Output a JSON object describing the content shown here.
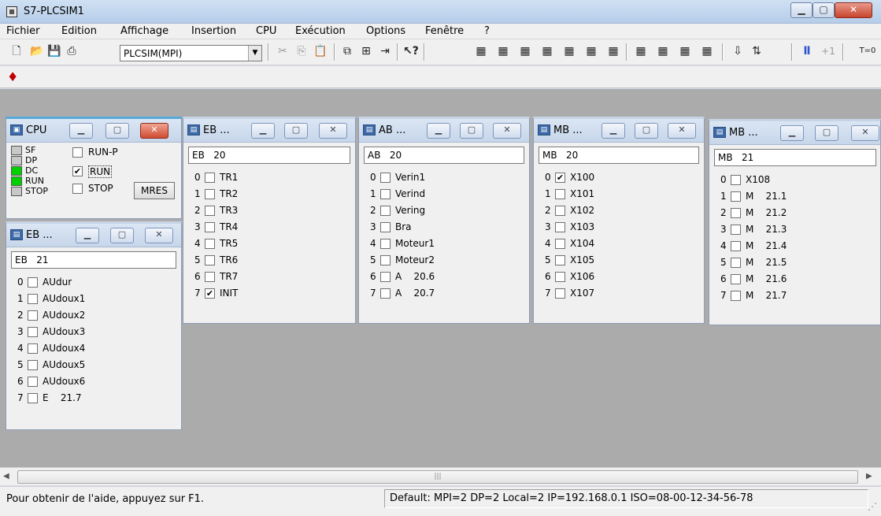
{
  "window": {
    "title": "S7-PLCSIM1"
  },
  "menu": [
    "Fichier",
    "Edition",
    "Affichage",
    "Insertion",
    "CPU",
    "Exécution",
    "Options",
    "Fenêtre",
    "?"
  ],
  "toolbar": {
    "combo_value": "PLCSIM(MPI)",
    "step_label": "+1",
    "timer_label": "T=0"
  },
  "cpu_window": {
    "title": "CPU",
    "leds": [
      {
        "label": "SF",
        "on": false
      },
      {
        "label": "DP",
        "on": false
      },
      {
        "label": "DC",
        "on": true
      },
      {
        "label": "RUN",
        "on": true
      },
      {
        "label": "STOP",
        "on": false
      }
    ],
    "modes": [
      {
        "label": "RUN-P",
        "checked": false
      },
      {
        "label": "RUN",
        "checked": true
      },
      {
        "label": "STOP",
        "checked": false
      }
    ],
    "mres_label": "MRES"
  },
  "windows": [
    {
      "title": "EB ...",
      "address": "EB   20",
      "bits": [
        {
          "num": "0",
          "label": "TR1",
          "checked": false
        },
        {
          "num": "1",
          "label": "TR2",
          "checked": false
        },
        {
          "num": "2",
          "label": "TR3",
          "checked": false
        },
        {
          "num": "3",
          "label": "TR4",
          "checked": false
        },
        {
          "num": "4",
          "label": "TR5",
          "checked": false
        },
        {
          "num": "5",
          "label": "TR6",
          "checked": false
        },
        {
          "num": "6",
          "label": "TR7",
          "checked": false
        },
        {
          "num": "7",
          "label": "INIT",
          "checked": true
        }
      ]
    },
    {
      "title": "AB ...",
      "address": "AB   20",
      "bits": [
        {
          "num": "0",
          "label": "Verin1",
          "checked": false
        },
        {
          "num": "1",
          "label": "Verind",
          "checked": false
        },
        {
          "num": "2",
          "label": "Vering",
          "checked": false
        },
        {
          "num": "3",
          "label": "Bra",
          "checked": false
        },
        {
          "num": "4",
          "label": "Moteur1",
          "checked": false
        },
        {
          "num": "5",
          "label": "Moteur2",
          "checked": false
        },
        {
          "num": "6",
          "label": "A    20.6",
          "checked": false
        },
        {
          "num": "7",
          "label": "A    20.7",
          "checked": false
        }
      ]
    },
    {
      "title": "MB ...",
      "address": "MB   20",
      "bits": [
        {
          "num": "0",
          "label": "X100",
          "checked": true
        },
        {
          "num": "1",
          "label": "X101",
          "checked": false
        },
        {
          "num": "2",
          "label": "X102",
          "checked": false
        },
        {
          "num": "3",
          "label": "X103",
          "checked": false
        },
        {
          "num": "4",
          "label": "X104",
          "checked": false
        },
        {
          "num": "5",
          "label": "X105",
          "checked": false
        },
        {
          "num": "6",
          "label": "X106",
          "checked": false
        },
        {
          "num": "7",
          "label": "X107",
          "checked": false
        }
      ]
    },
    {
      "title": "MB ...",
      "address": "MB   21",
      "bits": [
        {
          "num": "0",
          "label": "X108",
          "checked": false
        },
        {
          "num": "1",
          "label": "M    21.1",
          "checked": false
        },
        {
          "num": "2",
          "label": "M    21.2",
          "checked": false
        },
        {
          "num": "3",
          "label": "M    21.3",
          "checked": false
        },
        {
          "num": "4",
          "label": "M    21.4",
          "checked": false
        },
        {
          "num": "5",
          "label": "M    21.5",
          "checked": false
        },
        {
          "num": "6",
          "label": "M    21.6",
          "checked": false
        },
        {
          "num": "7",
          "label": "M    21.7",
          "checked": false
        }
      ]
    },
    {
      "title": "EB ...",
      "address": "EB   21",
      "bits": [
        {
          "num": "0",
          "label": "AUdur",
          "checked": false
        },
        {
          "num": "1",
          "label": "AUdoux1",
          "checked": false
        },
        {
          "num": "2",
          "label": "AUdoux2",
          "checked": false
        },
        {
          "num": "3",
          "label": "AUdoux3",
          "checked": false
        },
        {
          "num": "4",
          "label": "AUdoux4",
          "checked": false
        },
        {
          "num": "5",
          "label": "AUdoux5",
          "checked": false
        },
        {
          "num": "6",
          "label": "AUdoux6",
          "checked": false
        },
        {
          "num": "7",
          "label": "E    21.7",
          "checked": false
        }
      ]
    }
  ],
  "status": {
    "help": "Pour obtenir de l'aide, appuyez sur F1.",
    "connection": "Default:  MPI=2 DP=2 Local=2 IP=192.168.0.1 ISO=08-00-12-34-56-78"
  }
}
